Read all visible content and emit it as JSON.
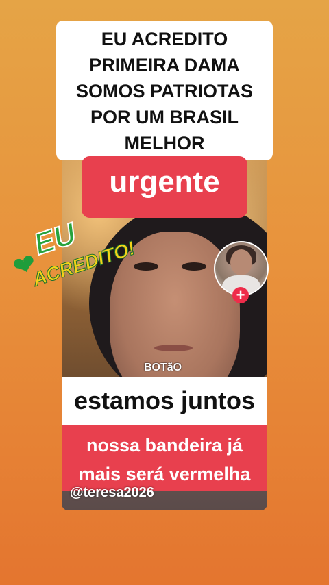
{
  "caption": {
    "lines": [
      "EU ACREDITO",
      "PRIMEIRA DAMA",
      "SOMOS PATRIOTAS",
      "POR UM BRASIL",
      "MELHOR"
    ]
  },
  "urgente_label": "urgente",
  "stamp": {
    "line1": "EU",
    "line2": "ACREDITO!",
    "icon": "brazil-heart-icon"
  },
  "watermark": "BOTãO",
  "juntos_label": "estamos juntos",
  "bandeira": {
    "line1": "nossa bandeira já",
    "line2": "mais será vermelha"
  },
  "handle": "@teresa2026",
  "follow_button_label": "+",
  "colors": {
    "accent_red": "#e8404e",
    "follow_red": "#ee2c4a",
    "stamp_green": "#27a33d",
    "stamp_yellow": "#f3d21a"
  }
}
